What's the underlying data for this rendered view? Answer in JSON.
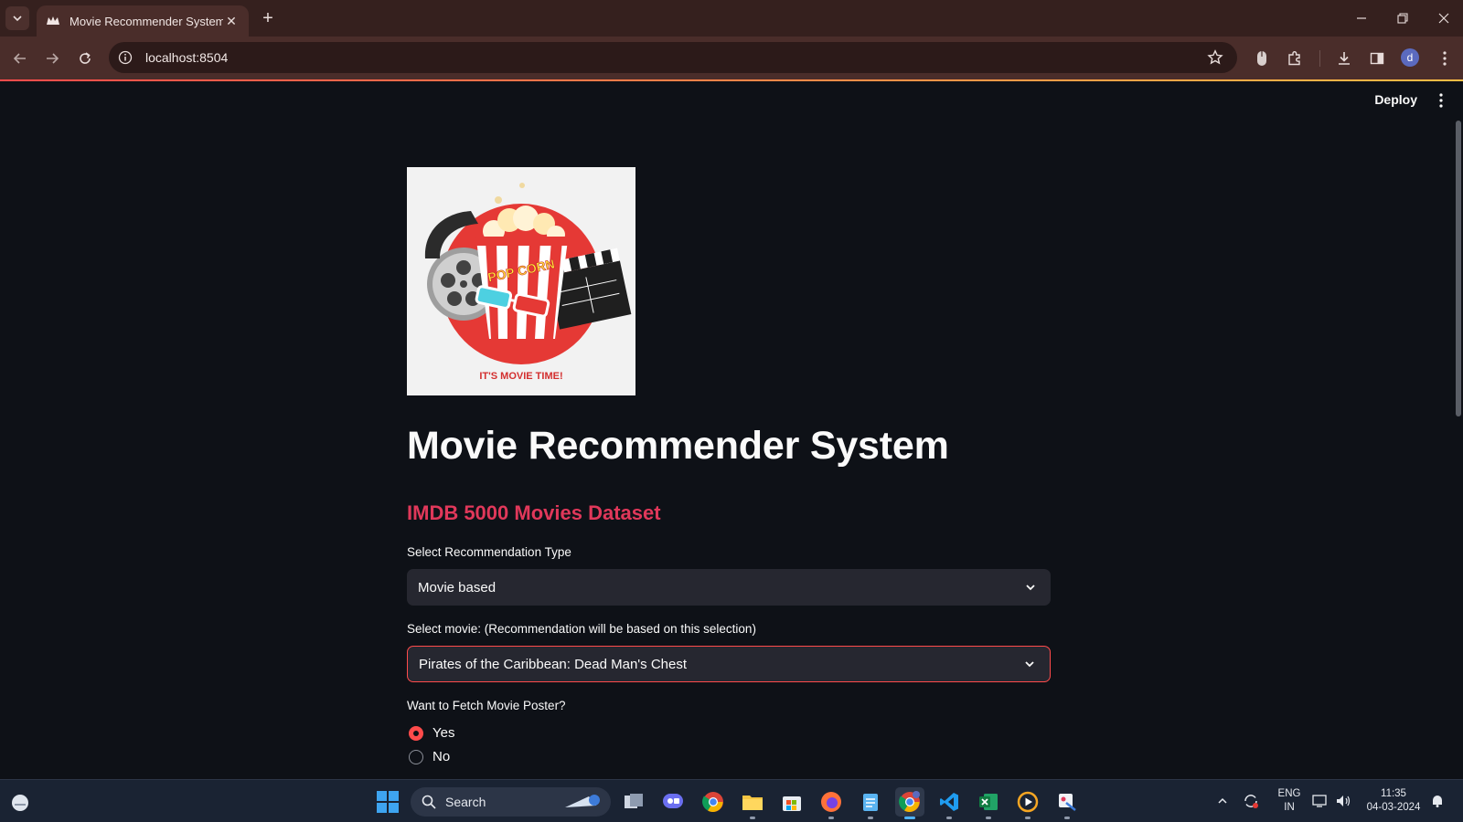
{
  "browser": {
    "tab_title": "Movie Recommender System",
    "url": "localhost:8504",
    "profile_initial": "d"
  },
  "app": {
    "deploy_label": "Deploy",
    "logo_caption": "IT'S MOVIE TIME!",
    "logo_popcorn_text": "POP CORN",
    "title": "Movie Recommender System",
    "subheader": "IMDB 5000 Movies Dataset",
    "recommendation_type": {
      "label": "Select Recommendation Type",
      "value": "Movie based"
    },
    "movie_select": {
      "label": "Select movie: (Recommendation will be based on this selection)",
      "value": "Pirates of the Caribbean: Dead Man's Chest"
    },
    "poster_question": {
      "label": "Want to Fetch Movie Poster?",
      "options": [
        "Yes",
        "No"
      ],
      "selected": "Yes"
    }
  },
  "taskbar": {
    "search_label": "Search",
    "language": "ENG",
    "region": "IN",
    "time": "11:35",
    "date": "04-03-2024"
  },
  "colors": {
    "accent": "#ff4b4b",
    "subheader": "#e0385a",
    "background": "#0e1117",
    "widget": "#262730"
  }
}
